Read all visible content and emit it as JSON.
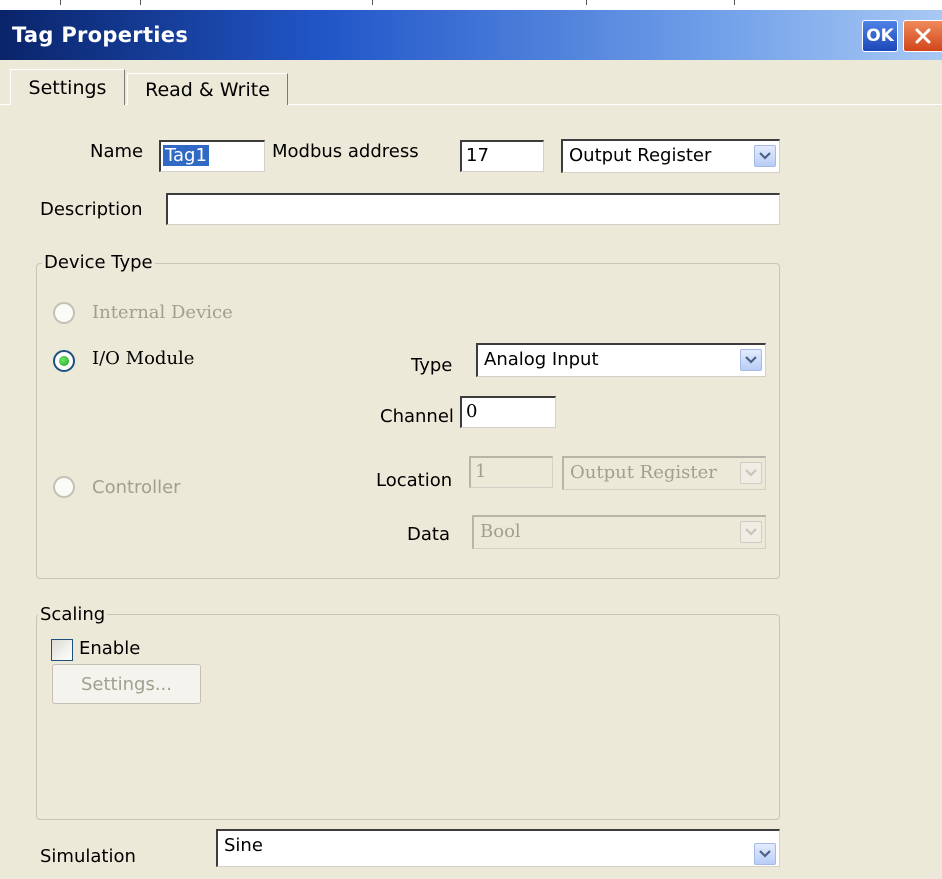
{
  "window": {
    "title": "Tag Properties",
    "ok_label": "OK"
  },
  "tabs": [
    {
      "label": "Settings",
      "active": true
    },
    {
      "label": "Read & Write",
      "active": false
    }
  ],
  "name": {
    "label": "Name",
    "value": "Tag1"
  },
  "modbus": {
    "label": "Modbus address",
    "value": "17",
    "register_type": "Output Register"
  },
  "description": {
    "label": "Description",
    "value": ""
  },
  "device_type": {
    "title": "Device Type",
    "options": [
      {
        "label": "Internal Device",
        "selected": false,
        "enabled": false
      },
      {
        "label": "I/O Module",
        "selected": true,
        "enabled": true
      },
      {
        "label": "Controller",
        "selected": false,
        "enabled": false
      }
    ],
    "type": {
      "label": "Type",
      "value": "Analog Input"
    },
    "channel": {
      "label": "Channel",
      "value": "0"
    },
    "location": {
      "label": "Location",
      "value": "1",
      "register": "Output Register"
    },
    "data": {
      "label": "Data",
      "value": "Bool"
    }
  },
  "scaling": {
    "title": "Scaling",
    "enable_label": "Enable",
    "enabled": false,
    "settings_label": "Settings..."
  },
  "simulation": {
    "label": "Simulation",
    "value": "Sine"
  },
  "colors": {
    "title_bar_start": "#0a246a",
    "title_bar_end": "#a8c8f4",
    "dialog_bg": "#ece9d8",
    "radio_selected": "#1aa01a",
    "close_button": "#d2451b"
  }
}
